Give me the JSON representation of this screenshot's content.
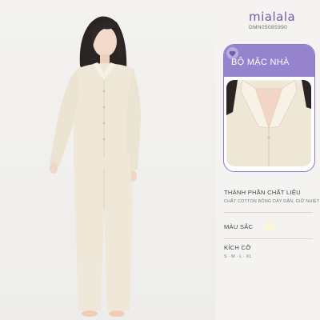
{
  "brand": "mialala",
  "sku": "DMN05085990",
  "card": {
    "title": "BỘ MẶC NHÀ",
    "badge_icon": "heart-icon"
  },
  "material": {
    "label": "THÀNH PHẦN CHẤT LIỆU",
    "value": "CHẤT COTTON BÔNG DÀY DẶN, GIỮ NHIỆT"
  },
  "color": {
    "label": "MÀU SẮC",
    "swatch": "#fbf6d8"
  },
  "size": {
    "label": "KÍCH CỠ",
    "value": "S · M · L · XL"
  },
  "colors": {
    "accent": "#9583cd",
    "brand": "#6f5ba7",
    "garment": "#efe8d8"
  }
}
